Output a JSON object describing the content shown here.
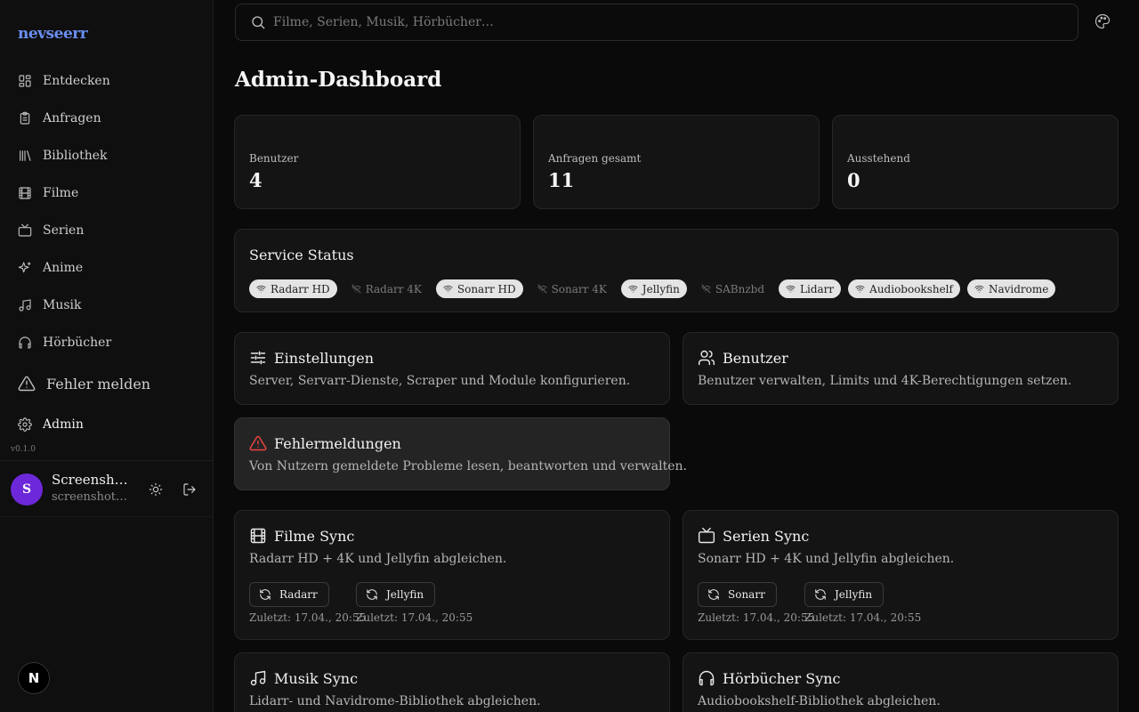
{
  "brand": "nevseerr",
  "sidebar": {
    "items": [
      {
        "label": "Entdecken"
      },
      {
        "label": "Anfragen"
      },
      {
        "label": "Bibliothek"
      },
      {
        "label": "Filme"
      },
      {
        "label": "Serien"
      },
      {
        "label": "Anime"
      },
      {
        "label": "Musik"
      },
      {
        "label": "Hörbücher"
      }
    ],
    "report_label": "Fehler melden",
    "admin_label": "Admin",
    "version": "v0.1.0"
  },
  "user": {
    "initial": "S",
    "name": "Screenshot …",
    "email": "screenshot@t…"
  },
  "search": {
    "placeholder": "Filme, Serien, Musik, Hörbücher…"
  },
  "page": {
    "title": "Admin-Dashboard"
  },
  "stats": [
    {
      "label": "Benutzer",
      "value": "4"
    },
    {
      "label": "Anfragen gesamt",
      "value": "11"
    },
    {
      "label": "Ausstehend",
      "value": "0"
    }
  ],
  "service_status": {
    "title": "Service Status",
    "services": [
      {
        "name": "Radarr HD",
        "online": true
      },
      {
        "name": "Radarr 4K",
        "online": false
      },
      {
        "name": "Sonarr HD",
        "online": true
      },
      {
        "name": "Sonarr 4K",
        "online": false
      },
      {
        "name": "Jellyfin",
        "online": true
      },
      {
        "name": "SABnzbd",
        "online": false
      },
      {
        "name": "Lidarr",
        "online": true
      },
      {
        "name": "Audiobookshelf",
        "online": true
      },
      {
        "name": "Navidrome",
        "online": true
      }
    ]
  },
  "actions": {
    "settings": {
      "title": "Einstellungen",
      "desc": "Server, Servarr-Dienste, Scraper und Module konfigurieren."
    },
    "users": {
      "title": "Benutzer",
      "desc": "Benutzer verwalten, Limits und 4K-Berechtigungen setzen."
    },
    "reports": {
      "title": "Fehlermeldungen",
      "desc": "Von Nutzern gemeldete Probleme lesen, beantworten und verwalten."
    }
  },
  "sync": {
    "movies": {
      "title": "Filme Sync",
      "desc": "Radarr HD + 4K und Jellyfin abgleichen.",
      "buttons": [
        {
          "label": "Radarr",
          "last": "Zuletzt: 17.04., 20:55"
        },
        {
          "label": "Jellyfin",
          "last": "Zuletzt: 17.04., 20:55"
        }
      ]
    },
    "series": {
      "title": "Serien Sync",
      "desc": "Sonarr HD + 4K und Jellyfin abgleichen.",
      "buttons": [
        {
          "label": "Sonarr",
          "last": "Zuletzt: 17.04., 20:55"
        },
        {
          "label": "Jellyfin",
          "last": "Zuletzt: 17.04., 20:55"
        }
      ]
    },
    "music": {
      "title": "Musik Sync",
      "desc": "Lidarr- und Navidrome-Bibliothek abgleichen."
    },
    "audiobooks": {
      "title": "Hörbücher Sync",
      "desc": "Audiobookshelf-Bibliothek abgleichen."
    }
  },
  "colors": {
    "accent_brand": "#6a8ef0",
    "avatar": "#6d28d9",
    "error": "#ef4444",
    "chip_online": "#e4e4e4"
  }
}
